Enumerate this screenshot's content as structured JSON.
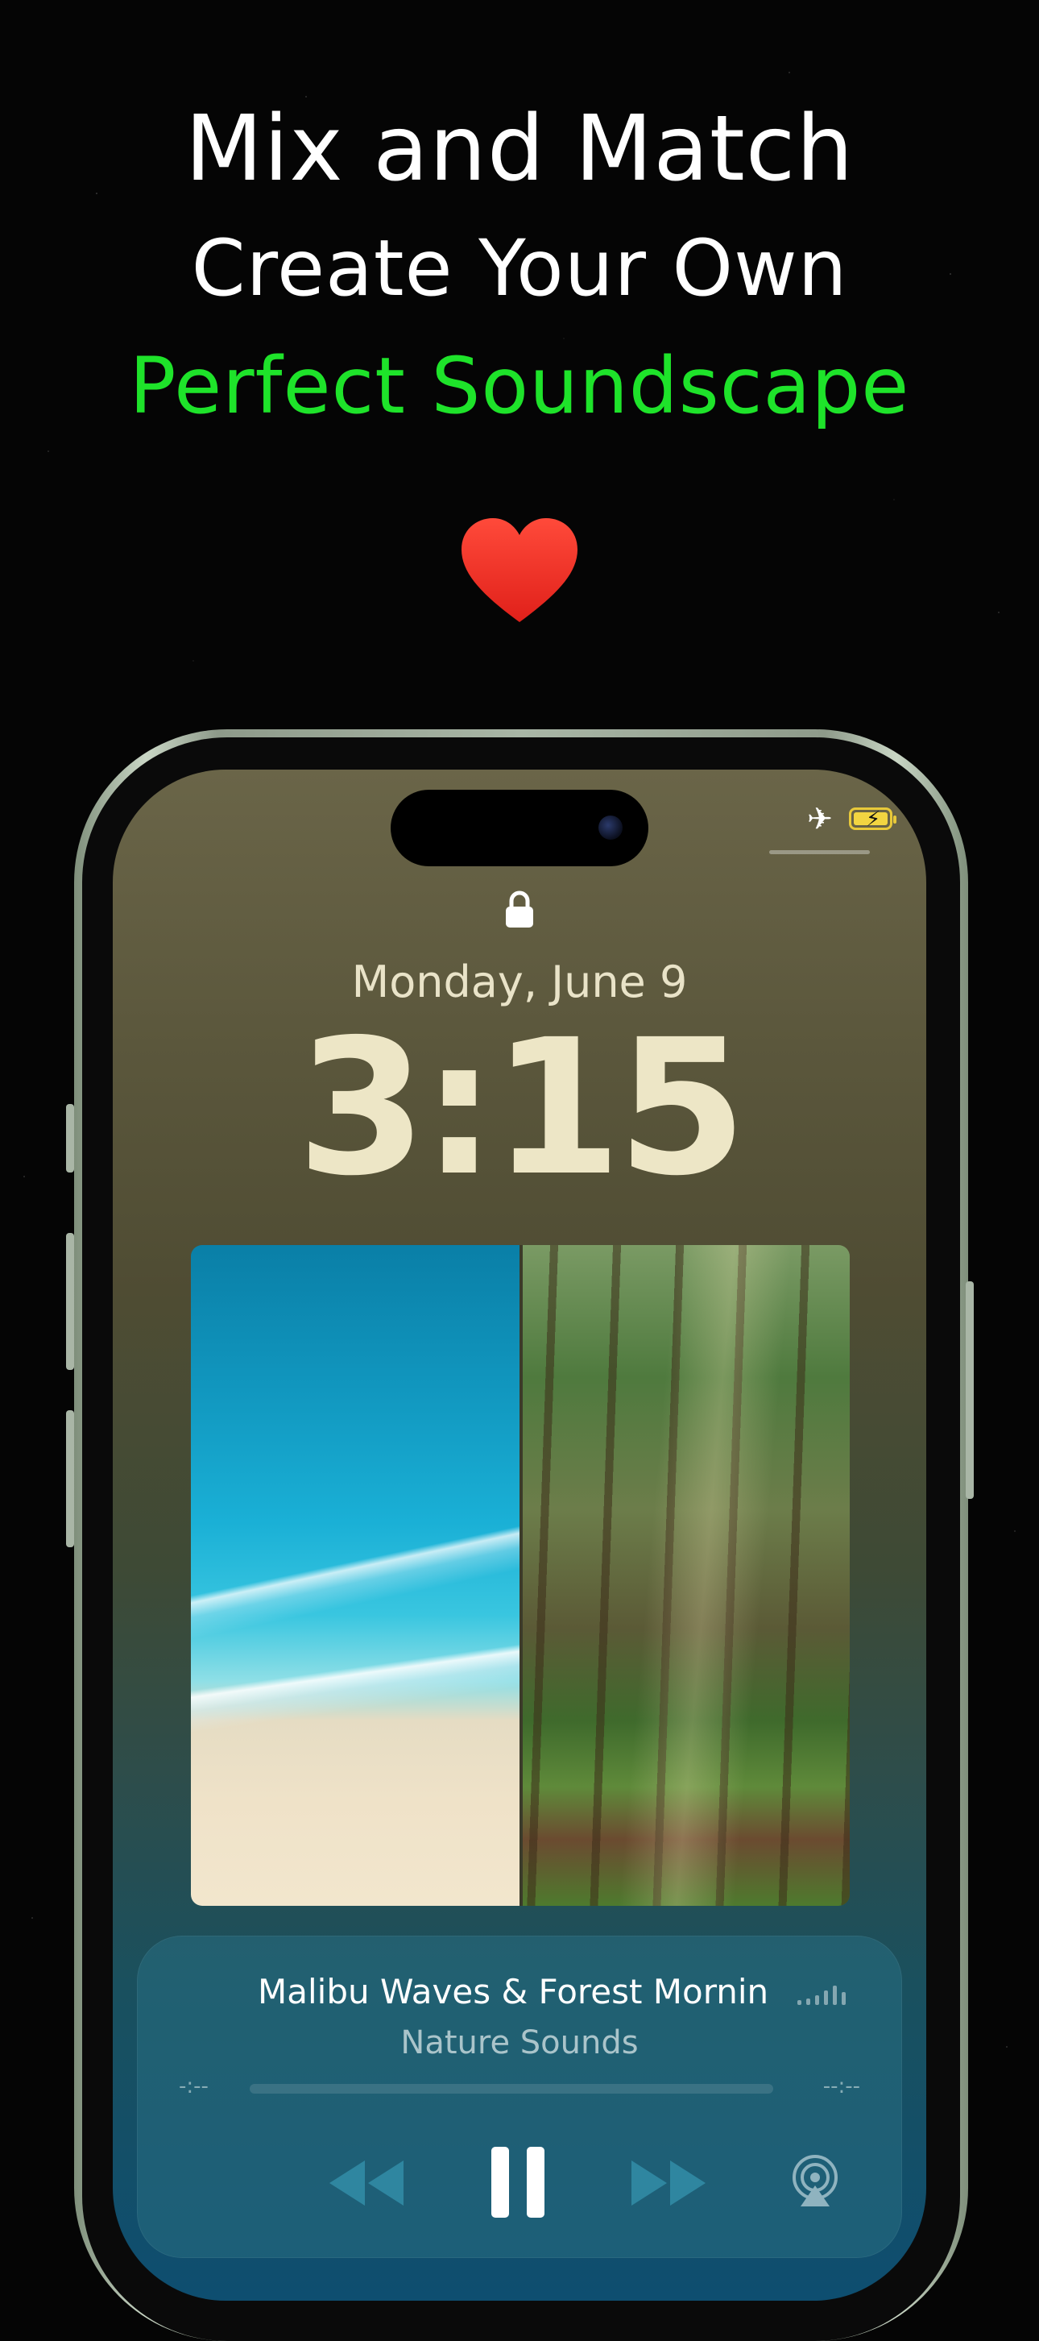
{
  "hero": {
    "line1": "Mix and Match",
    "line2": "Create Your Own",
    "line3": "Perfect Soundscape",
    "accent_color": "#1ee32a",
    "heart_icon": "heart-icon"
  },
  "status_bar": {
    "icons": [
      "airplane-icon",
      "battery-charging-icon"
    ]
  },
  "lock_screen": {
    "date": "Monday, June 9",
    "time": "3:15",
    "lock_icon": "lock-icon"
  },
  "now_playing": {
    "title": "Malibu Waves & Forest Mornin",
    "subtitle": "Nature Sounds",
    "elapsed": "-:--",
    "remaining": "--:--",
    "progress": 0,
    "controls": [
      "rewind-icon",
      "pause-icon",
      "fast-forward-icon",
      "airplay-icon"
    ]
  }
}
